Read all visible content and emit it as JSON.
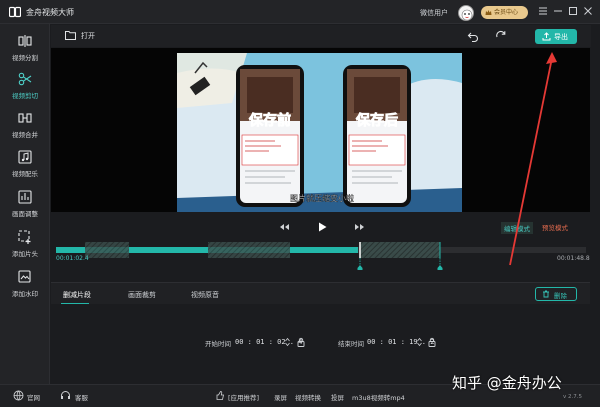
{
  "app": {
    "title": "金舟视频大师",
    "user_label": "微信用户",
    "vip_label": "会员中心"
  },
  "sidebar": {
    "items": [
      {
        "label": "视频分割",
        "icon": "split-icon"
      },
      {
        "label": "视频剪切",
        "icon": "cut-icon",
        "active": true
      },
      {
        "label": "视频合并",
        "icon": "merge-icon"
      },
      {
        "label": "视频配乐",
        "icon": "music-icon"
      },
      {
        "label": "画面调整",
        "icon": "adjust-icon"
      },
      {
        "label": "添加片头",
        "icon": "add-intro-icon"
      },
      {
        "label": "添加水印",
        "icon": "add-watermark-icon"
      }
    ]
  },
  "toolbar": {
    "open_label": "打开",
    "export_label": "导出"
  },
  "video": {
    "label_before": "保存前",
    "label_after": "保存后",
    "caption": "图片就压缩变小啦"
  },
  "modes": {
    "edit": "编辑模式",
    "preview": "预览模式"
  },
  "timeline": {
    "current_time": "00:01:02.4",
    "total_time": "00:01:48.8",
    "playhead_fraction": 0.57
  },
  "tabs": {
    "items": [
      "删减片段",
      "画面裁剪",
      "视频原音"
    ],
    "delete_label": "删除"
  },
  "clip": {
    "start_label": "开始时间",
    "start_value": "00 : 01 : 02 . 4",
    "end_label": "结束时间",
    "end_value": "00 : 01 : 19 . 2"
  },
  "statusbar": {
    "website": "官网",
    "service": "客服",
    "recommend": "[应用推荐]",
    "links": [
      "录屏",
      "视频转换",
      "投屏",
      "m3u8视频转mp4"
    ],
    "version": "v 2.7.5"
  },
  "watermark": "知乎 @金舟办公",
  "colors": {
    "accent": "#23b7a9",
    "annotation_arrow": "#e53935"
  }
}
